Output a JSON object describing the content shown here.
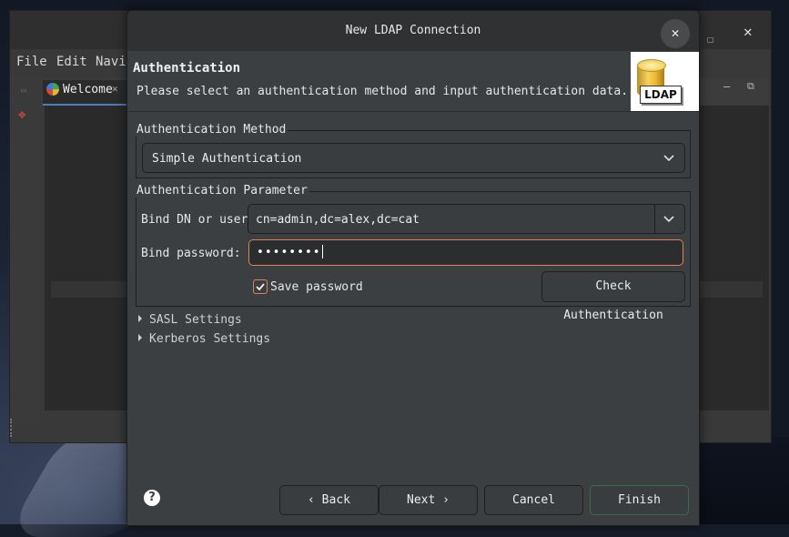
{
  "background_window": {
    "menu": [
      "File",
      "Edit",
      "Navig"
    ],
    "tab_label": "Welcome",
    "close_glyph": "✕",
    "restore_glyph": "☐"
  },
  "dialog": {
    "title": "New LDAP Connection",
    "close_glyph": "✕",
    "header": {
      "title": "Authentication",
      "description": "Please select an authentication method and input authentication data.",
      "logo_text": "LDAP"
    },
    "auth_method": {
      "group_label": "Authentication Method",
      "selected": "Simple Authentication"
    },
    "auth_params": {
      "group_label": "Authentication Parameter",
      "bind_dn_label": "Bind DN or user:",
      "bind_dn_value": "cn=admin,dc=alex,dc=cat",
      "bind_password_label": "Bind password:",
      "bind_password_value": "••••••••",
      "save_password_label": "Save password",
      "save_password_checked": true,
      "check_auth_label": "Check Authentication"
    },
    "sections": {
      "sasl": "SASL Settings",
      "kerberos": "Kerberos Settings"
    },
    "buttons": {
      "help": "?",
      "back": "‹ Back",
      "next": "Next ›",
      "cancel": "Cancel",
      "finish": "Finish"
    }
  },
  "colors": {
    "dialog_bg": "#3c3f41",
    "focus_accent": "#e0815a",
    "finish_border": "#3d6b48"
  }
}
